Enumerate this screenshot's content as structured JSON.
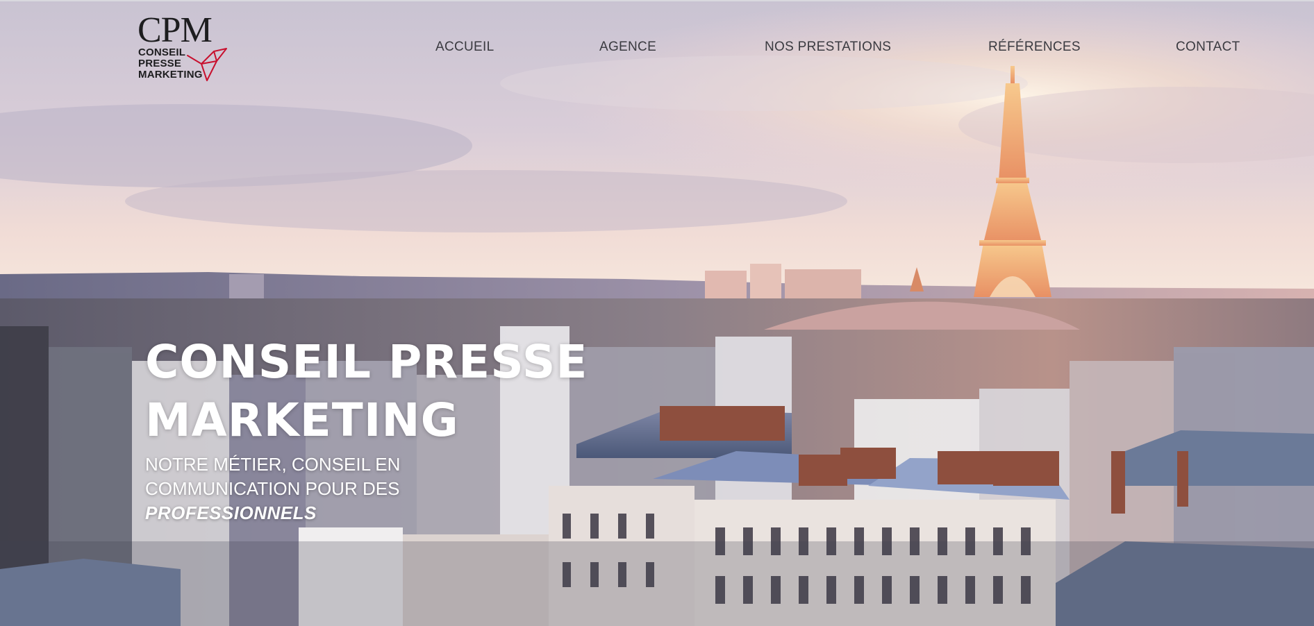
{
  "logo": {
    "mark": "CPM",
    "lines": [
      "CONSEIL",
      "PRESSE",
      "MARKETING"
    ],
    "icon": "origami-bird-icon",
    "accent_color": "#c8102e"
  },
  "nav": {
    "items": [
      {
        "label": "ACCUEIL"
      },
      {
        "label": "AGENCE"
      },
      {
        "label": "NOS PRESTATIONS"
      },
      {
        "label": "RÉFÉRENCES"
      },
      {
        "label": "CONTACT"
      }
    ]
  },
  "hero": {
    "title_lines": [
      "CONSEIL PRESSE",
      "MARKETING"
    ],
    "subtitle_lines": [
      "NOTRE MÉTIER, CONSEIL EN",
      "COMMUNICATION POUR DES"
    ],
    "subtitle_emphasis": "PROFESSIONNELS",
    "background": "paris-skyline-sunset-eiffel-tower"
  }
}
